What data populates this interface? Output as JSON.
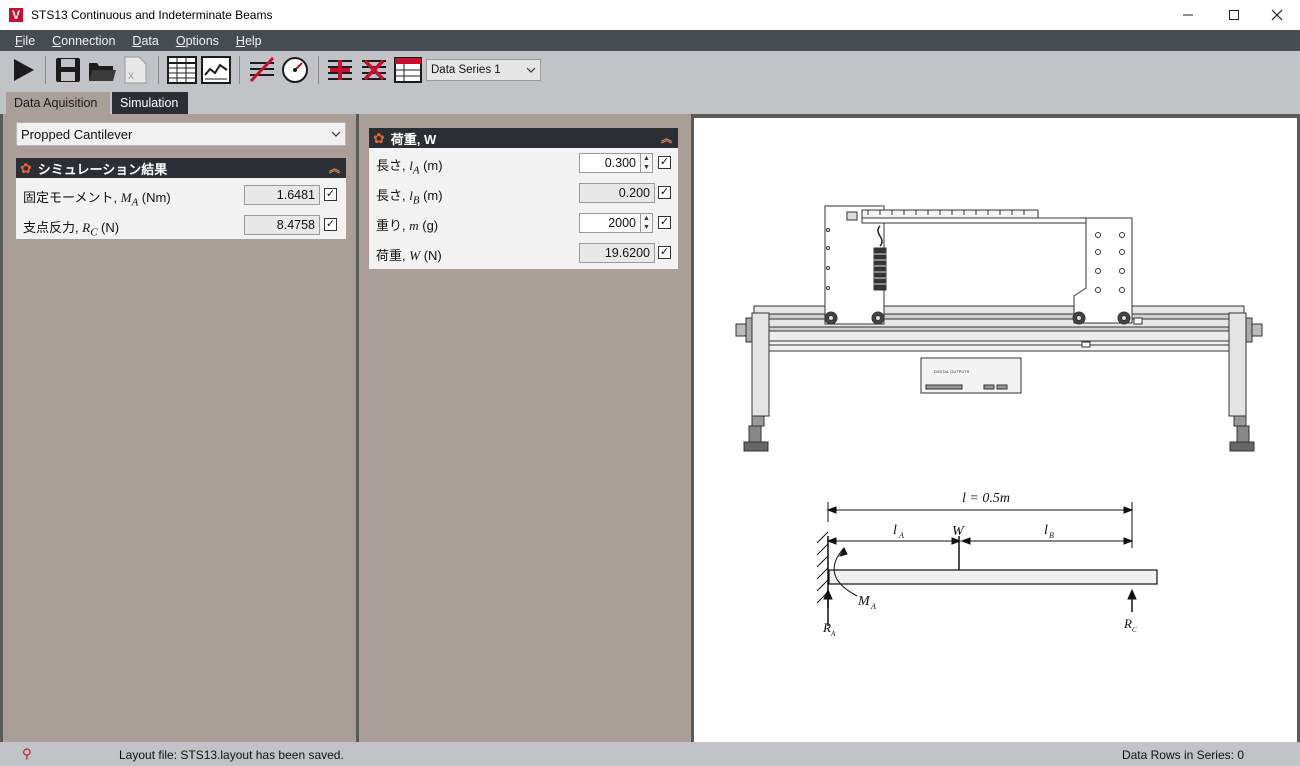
{
  "window": {
    "title": "STS13 Continuous and Indeterminate Beams",
    "logo": "V"
  },
  "menu": [
    {
      "pre": "",
      "u": "F",
      "post": "ile"
    },
    {
      "pre": "",
      "u": "C",
      "post": "onnection"
    },
    {
      "pre": "",
      "u": "D",
      "post": "ata"
    },
    {
      "pre": "",
      "u": "O",
      "post": "ptions"
    },
    {
      "pre": "",
      "u": "H",
      "post": "elp"
    }
  ],
  "toolbar": {
    "icons": [
      "play-icon",
      "save-icon",
      "open-folder-icon",
      "excel-export-icon",
      "table-view-icon",
      "chart-view-icon",
      "zero-icon",
      "gauge-icon",
      "add-series-icon",
      "delete-series-icon",
      "series-table-icon"
    ],
    "series_select": "Data Series 1"
  },
  "tabs": {
    "daq": "Data Aquisition",
    "sim": "Simulation"
  },
  "model_select": "Propped Cantilever",
  "results": {
    "title": "シミュレーション結果",
    "rows": [
      {
        "label": "固定モーメント, ",
        "sym": "M",
        "sub": "A",
        "unit": " (Nm)",
        "value": "1.6481"
      },
      {
        "label": "支点反力, ",
        "sym": "R",
        "sub": "C",
        "unit": " (N)",
        "value": "8.4758"
      }
    ]
  },
  "load": {
    "title": "荷重, W",
    "rows": [
      {
        "label": "長さ, ",
        "sym": "l",
        "sub": "A",
        "unit": " (m)",
        "value": "0.300",
        "editable": true
      },
      {
        "label": "長さ, ",
        "sym": "l",
        "sub": "B",
        "unit": " (m)",
        "value": "0.200",
        "editable": false
      },
      {
        "label": "重り, ",
        "sym": "m",
        "sub": "",
        "unit": " (g)",
        "value": "2000",
        "editable": true
      },
      {
        "label": "荷重, ",
        "sym": "W",
        "sub": "",
        "unit": " (N)",
        "value": "19.6200",
        "editable": false
      }
    ]
  },
  "diagram": {
    "controller_label": "DIGITAL OUTPUTS",
    "total_length": "l = 0.5m",
    "la": "l",
    "la_sub": "A",
    "w": "W",
    "lb": "l",
    "lb_sub": "B",
    "ma": "M",
    "ma_sub": "A",
    "ra": "R",
    "ra_sub": "A",
    "rc": "R",
    "rc_sub": "C"
  },
  "status": {
    "message": "Layout file: STS13.layout has been saved.",
    "rows": "Data Rows in Series: 0"
  }
}
